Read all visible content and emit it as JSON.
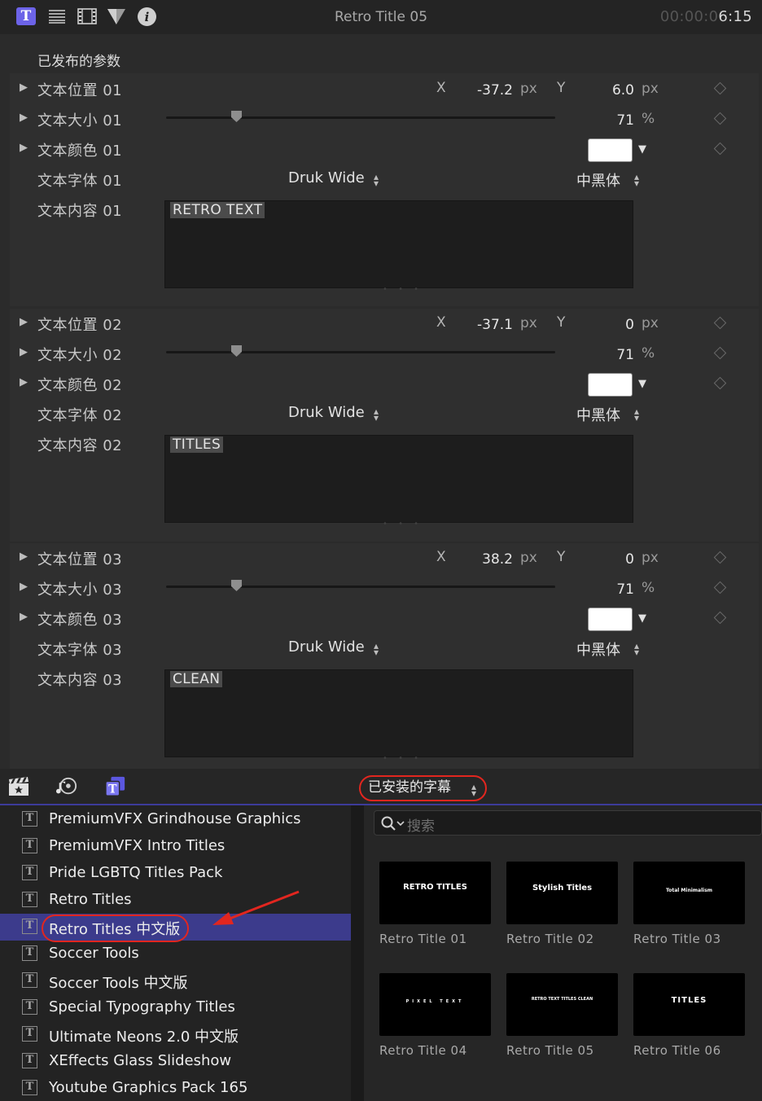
{
  "header": {
    "title": "Retro Title 05",
    "timecode_dim": "00:00:0",
    "timecode_lit": "6:15",
    "icons": [
      "text-inspector-icon",
      "lines-icon",
      "film-icon",
      "shape-icon",
      "info-icon"
    ]
  },
  "published": {
    "heading": "已发布的参数",
    "groups": [
      {
        "position_label": "文本位置 01",
        "x_axis": "X",
        "x_value": "-37.2",
        "x_unit": "px",
        "y_axis": "Y",
        "y_value": "6.0",
        "y_unit": "px",
        "size_label": "文本大小 01",
        "size_value": "71",
        "size_unit": "%",
        "size_level": 0.18,
        "color_label": "文本颜色 01",
        "color_value": "#ffffff",
        "font_label": "文本字体 01",
        "font_family": "Druk Wide",
        "font_style": "中黑体",
        "content_label": "文本内容 01",
        "content_text": "RETRO TEXT"
      },
      {
        "position_label": "文本位置 02",
        "x_axis": "X",
        "x_value": "-37.1",
        "x_unit": "px",
        "y_axis": "Y",
        "y_value": "0",
        "y_unit": "px",
        "size_label": "文本大小 02",
        "size_value": "71",
        "size_unit": "%",
        "size_level": 0.18,
        "color_label": "文本颜色 02",
        "color_value": "#ffffff",
        "font_label": "文本字体 02",
        "font_family": "Druk Wide",
        "font_style": "中黑体",
        "content_label": "文本内容 02",
        "content_text": "TITLES"
      },
      {
        "position_label": "文本位置 03",
        "x_axis": "X",
        "x_value": "38.2",
        "x_unit": "px",
        "y_axis": "Y",
        "y_value": "0",
        "y_unit": "px",
        "size_label": "文本大小 03",
        "size_value": "71",
        "size_unit": "%",
        "size_level": 0.18,
        "color_label": "文本颜色 03",
        "color_value": "#ffffff",
        "font_label": "文本字体 03",
        "font_family": "Druk Wide",
        "font_style": "中黑体",
        "content_label": "文本内容 03",
        "content_text": "CLEAN"
      }
    ]
  },
  "browser": {
    "tab_icons": [
      "clapper-icon",
      "music-icon",
      "titles-icon"
    ],
    "source_selector": "已安装的字幕",
    "search_placeholder": "搜索",
    "sidebar_items": [
      {
        "label": "PremiumVFX Grindhouse Graphics",
        "selected": false
      },
      {
        "label": "PremiumVFX Intro Titles",
        "selected": false
      },
      {
        "label": "Pride LGBTQ Titles Pack",
        "selected": false
      },
      {
        "label": "Retro Titles",
        "selected": false
      },
      {
        "label": "Retro Titles 中文版",
        "selected": true
      },
      {
        "label": "Soccer Tools",
        "selected": false
      },
      {
        "label": "Soccer Tools 中文版",
        "selected": false
      },
      {
        "label": "Special Typography Titles",
        "selected": false
      },
      {
        "label": "Ultimate Neons 2.0 中文版",
        "selected": false
      },
      {
        "label": "XEffects Glass Slideshow",
        "selected": false
      },
      {
        "label": "Youtube Graphics Pack 165",
        "selected": false
      }
    ],
    "thumbnails": [
      {
        "caption": "Retro Title 01",
        "preview": "RETRO TITLES"
      },
      {
        "caption": "Retro Title 02",
        "preview": "Stylish Titles"
      },
      {
        "caption": "Retro Title 03",
        "preview": "Total Minimalism"
      },
      {
        "caption": "Retro Title 04",
        "preview": "PIXEL TEXT"
      },
      {
        "caption": "Retro Title 05",
        "preview": "RETRO TEXT TITLES CLEAN"
      },
      {
        "caption": "Retro Title 06",
        "preview": "TITLES"
      }
    ],
    "accent_color": "#3c3b8c",
    "highlight_color": "#e2261f"
  }
}
